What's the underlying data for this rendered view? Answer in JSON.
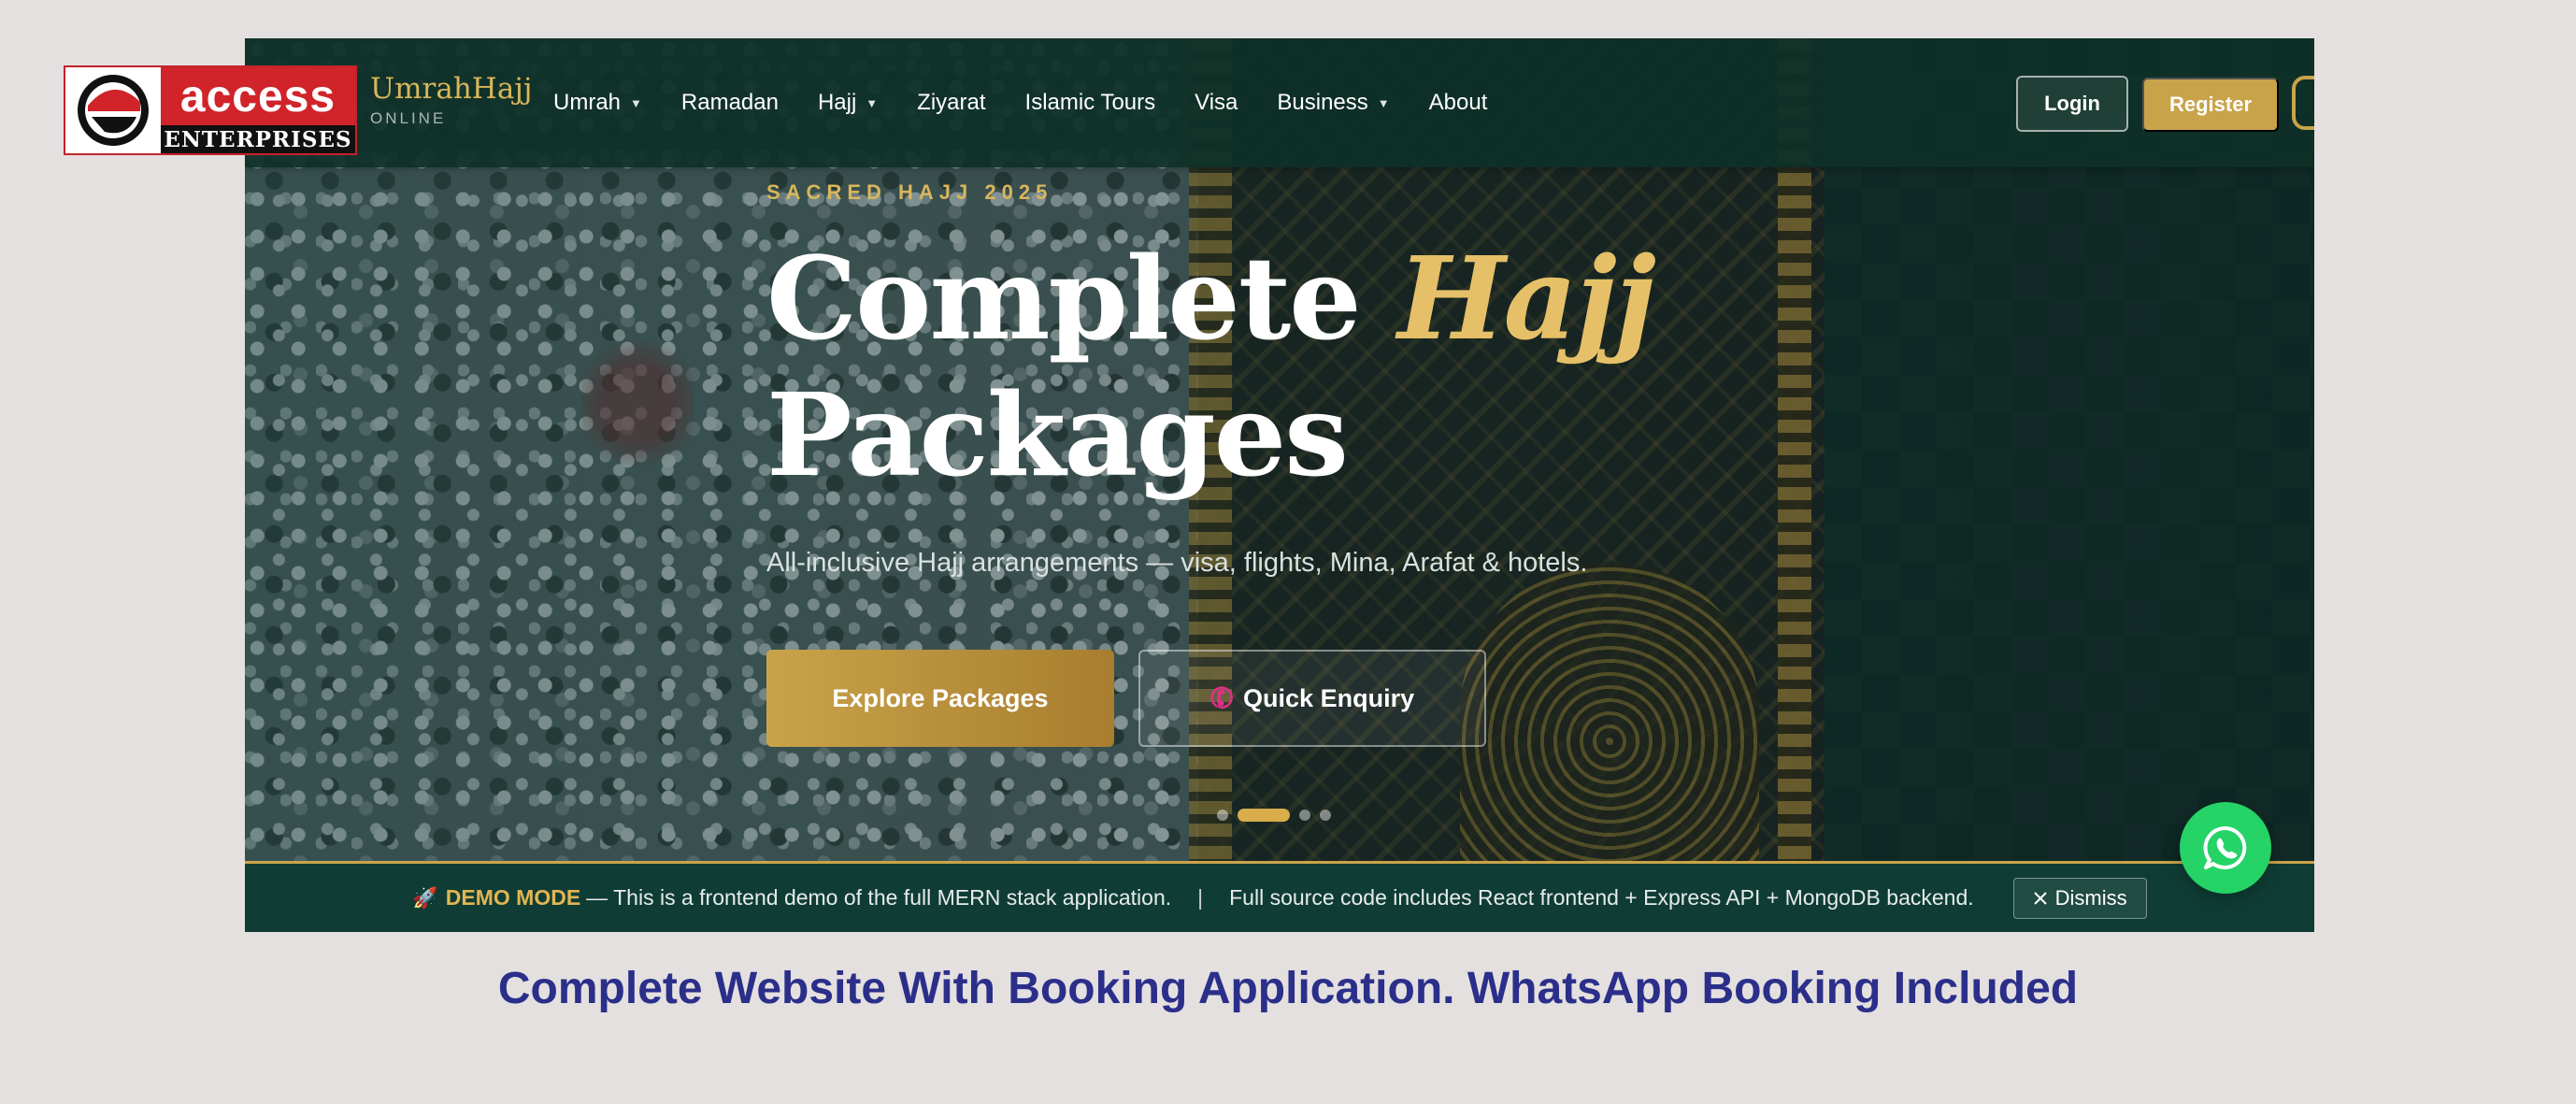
{
  "logo": {
    "top_text": "access",
    "bottom_text": "ENTERPRISES"
  },
  "header": {
    "brand_name": "UmrahHajj",
    "brand_sub": "ONLINE",
    "nav": [
      {
        "label": "Umrah",
        "dropdown": true
      },
      {
        "label": "Ramadan",
        "dropdown": false
      },
      {
        "label": "Hajj",
        "dropdown": true
      },
      {
        "label": "Ziyarat",
        "dropdown": false
      },
      {
        "label": "Islamic Tours",
        "dropdown": false
      },
      {
        "label": "Visa",
        "dropdown": false
      },
      {
        "label": "Business",
        "dropdown": true
      },
      {
        "label": "About",
        "dropdown": false
      }
    ],
    "login_label": "Login",
    "register_label": "Register"
  },
  "hero": {
    "eyebrow": "SACRED HAJJ 2025",
    "title_part1": "Complete",
    "title_accent": "Hajj",
    "title_part2": "Packages",
    "subtitle": "All-inclusive Hajj arrangements — visa, flights, Mina, Arafat & hotels.",
    "primary_button": "Explore Packages",
    "secondary_button": "Quick Enquiry",
    "slide_count": 4,
    "active_slide": 2
  },
  "demo_bar": {
    "icon": "rocket-icon",
    "label": "DEMO MODE",
    "message": "— This is a frontend demo of the full MERN stack application.",
    "separator": "|",
    "message2": "Full source code includes React frontend + Express API + MongoDB backend.",
    "dismiss_label": "Dismiss"
  },
  "whatsapp": {
    "icon": "whatsapp-icon"
  },
  "caption": "Complete Website With Booking Application. WhatsApp Booking Included",
  "colors": {
    "brand_green": "#0f3d35",
    "gold": "#c9a34a",
    "whatsapp": "#25d366",
    "caption": "#2b2f8a",
    "logo_red": "#d0242a"
  }
}
